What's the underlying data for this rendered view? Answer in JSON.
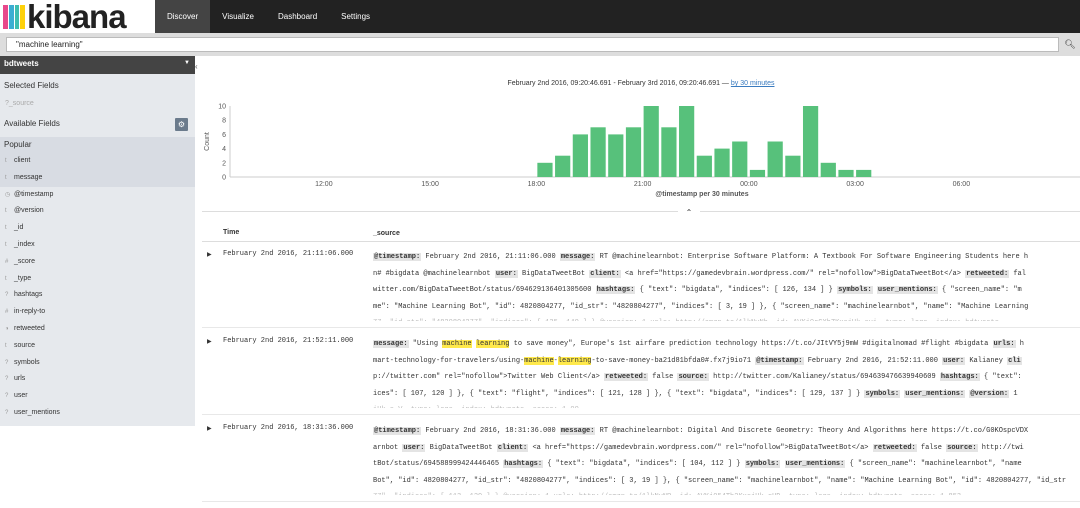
{
  "app": {
    "brand": "kibana",
    "stripe_colors": [
      "#e8488b",
      "#3caed2",
      "#3ebeb0",
      "#fed10a"
    ]
  },
  "nav": {
    "tabs": [
      {
        "label": "Discover",
        "active": true
      },
      {
        "label": "Visualize",
        "active": false
      },
      {
        "label": "Dashboard",
        "active": false
      },
      {
        "label": "Settings",
        "active": false
      }
    ]
  },
  "search": {
    "query": "\"machine learning\"",
    "button_icon": "search-icon"
  },
  "sidebar": {
    "index_pattern": "bdtweets",
    "selected_fields_label": "Selected Fields",
    "selected_fields": [
      {
        "type": "?",
        "name": "_source"
      }
    ],
    "available_fields_label": "Available Fields",
    "popular_label": "Popular",
    "popular_fields": [
      {
        "type": "t",
        "name": "client"
      },
      {
        "type": "t",
        "name": "message"
      }
    ],
    "fields": [
      {
        "type": "◷",
        "name": "@timestamp"
      },
      {
        "type": "t",
        "name": "@version"
      },
      {
        "type": "t",
        "name": "_id"
      },
      {
        "type": "t",
        "name": "_index"
      },
      {
        "type": "#",
        "name": "_score"
      },
      {
        "type": "t",
        "name": "_type"
      },
      {
        "type": "?",
        "name": "hashtags"
      },
      {
        "type": "#",
        "name": "in-reply-to"
      },
      {
        "type": "◑",
        "name": "retweeted"
      },
      {
        "type": "t",
        "name": "source"
      },
      {
        "type": "?",
        "name": "symbols"
      },
      {
        "type": "?",
        "name": "urls"
      },
      {
        "type": "?",
        "name": "user"
      },
      {
        "type": "?",
        "name": "user_mentions"
      }
    ]
  },
  "histogram": {
    "range_text": "February 2nd 2016, 09:20:46.691 - February 3rd 2016, 09:20:46.691 —",
    "interval_link": "by 30 minutes",
    "bar_color": "#57c17b",
    "chart_data": {
      "type": "bar",
      "ylabel": "Count",
      "xlabel": "@timestamp per 30 minutes",
      "ylim": [
        0,
        10
      ],
      "y_ticks": [
        0,
        2,
        4,
        6,
        8,
        10
      ],
      "x_tick_labels": [
        "12:00",
        "15:00",
        "18:00",
        "21:00",
        "00:00",
        "03:00",
        "06:00"
      ],
      "x_tick_hours": [
        12,
        15,
        18,
        21,
        24,
        27,
        30
      ],
      "x_domain_hours": [
        9.35,
        33.35
      ],
      "bar_start_hours": [
        18,
        18.5,
        19,
        19.5,
        20,
        20.5,
        21,
        21.5,
        22,
        22.5,
        23,
        23.5,
        24,
        24.5,
        25,
        25.5,
        26,
        26.5,
        27
      ],
      "values": [
        2,
        3,
        6,
        7,
        6,
        7,
        10,
        7,
        10,
        3,
        4,
        5,
        1,
        5,
        3,
        10,
        2,
        1,
        1
      ]
    }
  },
  "table": {
    "col_time": "Time",
    "col_source": "_source",
    "collapse_icon": "chevron-up-icon",
    "rows": [
      {
        "time": "February 2nd 2016, 21:11:06.000",
        "lines": [
          [
            {
              "k": "@timestamp:"
            },
            {
              "t": " February 2nd 2016, 21:11:06.000 "
            },
            {
              "k": "message:"
            },
            {
              "t": " RT @machinelearnbot: Enterprise Software Platform: A Textbook For Software Engineering Students here h"
            }
          ],
          [
            {
              "t": "n# #bigdata @machinelearnbot "
            },
            {
              "k": "user:"
            },
            {
              "t": " BigDataTweetBot "
            },
            {
              "k": "client:"
            },
            {
              "t": " <a href=\"https://gamedevbrain.wordpress.com/\" rel=\"nofollow\">BigDataTweetBot</a> "
            },
            {
              "k": "retweeted:"
            },
            {
              "t": " fal"
            }
          ],
          [
            {
              "t": "witter.com/BigDataTweetBot/status/694629136401305600 "
            },
            {
              "k": "hashtags:"
            },
            {
              "t": " { \"text\": \"bigdata\", \"indices\": [ 126, 134 ] } "
            },
            {
              "k": "symbols:"
            },
            {
              "t": "  "
            },
            {
              "k": "user_mentions:"
            },
            {
              "t": " { \"screen_name\": \"m"
            }
          ],
          [
            {
              "t": "me\": \"Machine Learning Bot\", \"id\": 4820804277, \"id_str\": \"4820804277\", \"indices\": [ 3, 19 ] }, { \"screen_name\": \"machinelearnbot\", \"name\": \"Machine Learning"
            }
          ],
          [
            {
              "t": "77, \"id_str\": \"4820804277\", \"indices\": [ 135, 140 ] } @version: 1 urls: http://amzn.to/1lkNvNb _id: AVKj0rCXhZKxsjUk_svi _type: logs _index: bdtweets",
              "fade": true
            }
          ]
        ]
      },
      {
        "time": "February 2nd 2016, 21:52:11.000",
        "lines": [
          [
            {
              "k": "message:"
            },
            {
              "t": " \"Using "
            },
            {
              "h": "machine"
            },
            {
              "t": " "
            },
            {
              "h": "learning"
            },
            {
              "t": " to save money\", Europe's 1st airfare prediction technology https://t.co/JItVY5j9mW #digitalnomad #flight #bigdata "
            },
            {
              "k": "urls:"
            },
            {
              "t": " h"
            }
          ],
          [
            {
              "t": "mart-technology-for-travelers/using-"
            },
            {
              "h": "machine"
            },
            {
              "t": "-"
            },
            {
              "h": "learning"
            },
            {
              "t": "-to-save-money-ba21d81bfda0#.fx7j9io71 "
            },
            {
              "k": "@timestamp:"
            },
            {
              "t": " February 2nd 2016, 21:52:11.000 "
            },
            {
              "k": "user:"
            },
            {
              "t": " Kalianey "
            },
            {
              "k": "cli"
            }
          ],
          [
            {
              "t": "p://twitter.com\" rel=\"nofollow\">Twitter Web Client</a> "
            },
            {
              "k": "retweeted:"
            },
            {
              "t": " false "
            },
            {
              "k": "source:"
            },
            {
              "t": " http://twitter.com/Kalianey/status/694639476639940609 "
            },
            {
              "k": "hashtags:"
            },
            {
              "t": " { \"text\":"
            }
          ],
          [
            {
              "t": "ices\": [ 107, 120 ] }, { \"text\": \"flight\", \"indices\": [ 121, 128 ] }, { \"text\": \"bigdata\", \"indices\": [ 129, 137 ] } "
            },
            {
              "k": "symbols:"
            },
            {
              "t": "  "
            },
            {
              "k": "user_mentions:"
            },
            {
              "t": "  "
            },
            {
              "k": "@version:"
            },
            {
              "t": " 1"
            }
          ],
          [
            {
              "t": "iUk_s-V _type: logs _index: bdtweets _score: 1.00",
              "fade": true
            }
          ]
        ]
      },
      {
        "time": "February 2nd 2016, 18:31:36.000",
        "lines": [
          [
            {
              "k": "@timestamp:"
            },
            {
              "t": " February 2nd 2016, 18:31:36.000 "
            },
            {
              "k": "message:"
            },
            {
              "t": " RT @machinelearnbot: Digital And Discrete Geometry: Theory And Algorithms here https://t.co/G0KOspcVDX"
            }
          ],
          [
            {
              "t": "arnbot "
            },
            {
              "k": "user:"
            },
            {
              "t": " BigDataTweetBot "
            },
            {
              "k": "client:"
            },
            {
              "t": " <a href=\"https://gamedevbrain.wordpress.com/\" rel=\"nofollow\">BigDataTweetBot</a> "
            },
            {
              "k": "retweeted:"
            },
            {
              "t": " false "
            },
            {
              "k": "source:"
            },
            {
              "t": " http://twi"
            }
          ],
          [
            {
              "t": "tBot/status/694588999424446465 "
            },
            {
              "k": "hashtags:"
            },
            {
              "t": " { \"text\": \"bigdata\", \"indices\": [ 104, 112 ] } "
            },
            {
              "k": "symbols:"
            },
            {
              "t": "  "
            },
            {
              "k": "user_mentions:"
            },
            {
              "t": " { \"screen_name\": \"machinelearnbot\", \"name"
            }
          ],
          [
            {
              "t": "Bot\", \"id\": 4820804277, \"id_str\": \"4820804277\", \"indices\": [ 3, 19 ] }, { \"screen_name\": \"machinelearnbot\", \"name\": \"Machine Learning Bot\", \"id\": 4820804277, \"id_str"
            }
          ],
          [
            {
              "t": "77\", \"indices\": [ 113, 129 ] } @version: 1 urls: http://amzn.to/1lkNvNR _id: AVKj054Tb2KxsjUk_rUD _type: logs _index: bdtweets _score: 1.853",
              "fade": true
            }
          ]
        ]
      }
    ]
  }
}
